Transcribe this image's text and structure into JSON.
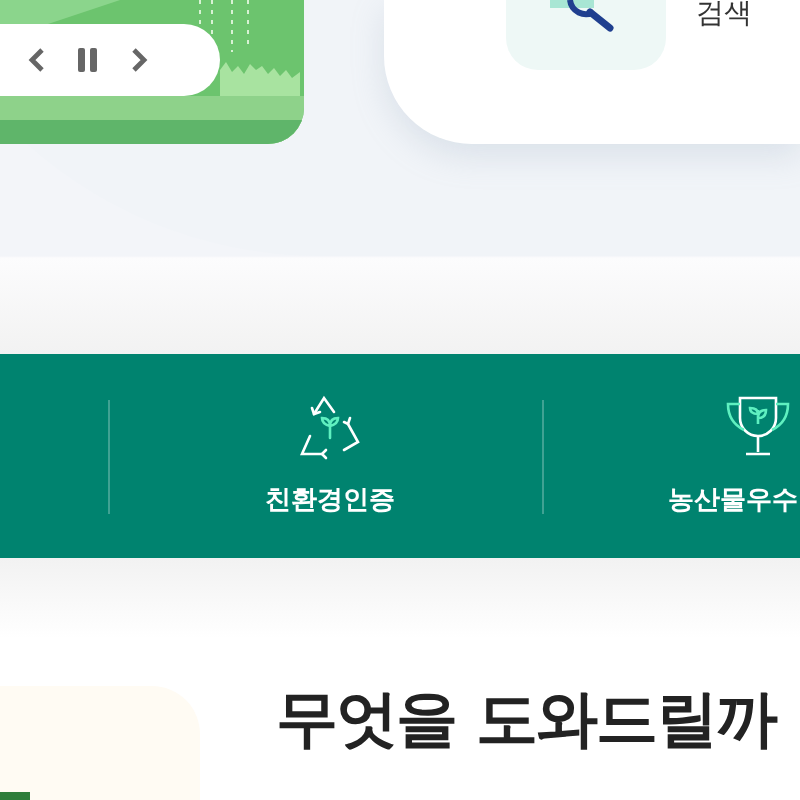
{
  "quick_menu": {
    "items": [
      {
        "label": "검색",
        "kind": "search"
      }
    ]
  },
  "certifications": [
    {
      "label": "친환경인증",
      "kind": "recycle"
    },
    {
      "label": "농산물우수",
      "kind": "trophy"
    }
  ],
  "help": {
    "heading": "무엇을 도와드릴까"
  }
}
